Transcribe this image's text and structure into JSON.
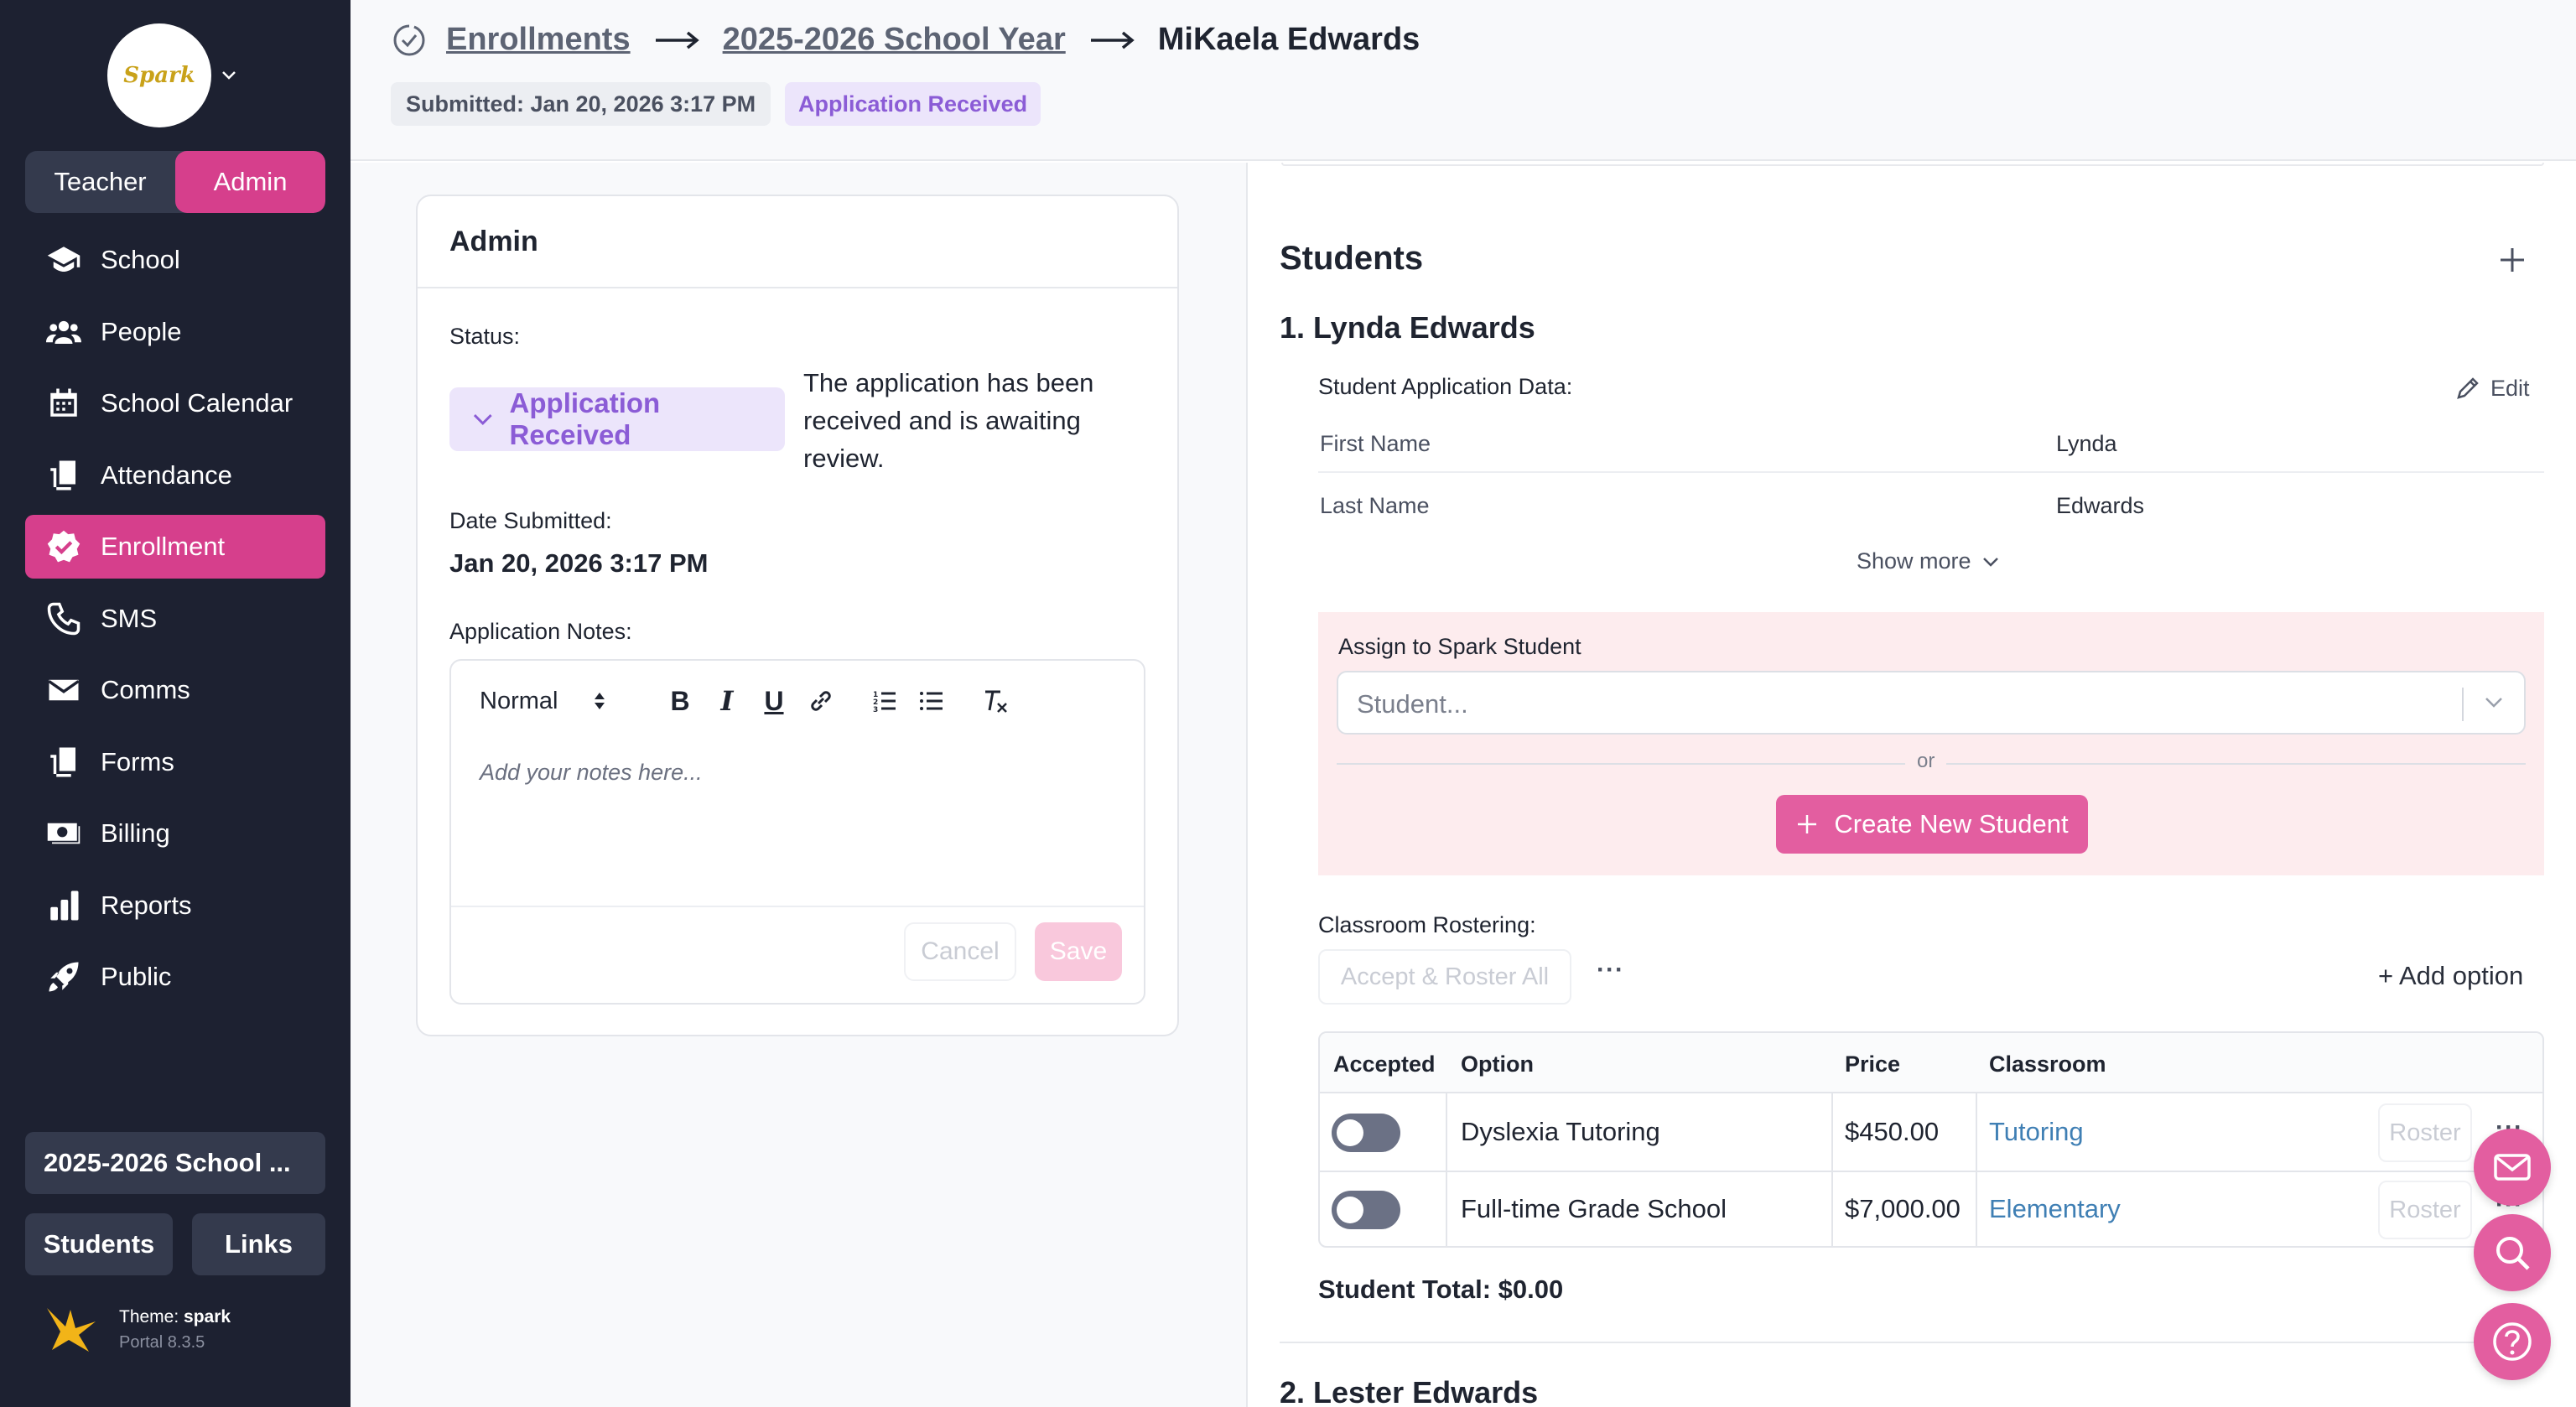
{
  "sidebar": {
    "logo_text": "Spark",
    "role_toggle": [
      "Teacher",
      "Admin"
    ],
    "nav": [
      {
        "label": "School",
        "icon": "graduation-cap-icon"
      },
      {
        "label": "People",
        "icon": "people-icon"
      },
      {
        "label": "School Calendar",
        "icon": "calendar-icon"
      },
      {
        "label": "Attendance",
        "icon": "clipboard-icon"
      },
      {
        "label": "Enrollment",
        "icon": "check-badge-icon",
        "active": true
      },
      {
        "label": "SMS",
        "icon": "phone-icon"
      },
      {
        "label": "Comms",
        "icon": "envelope-icon"
      },
      {
        "label": "Forms",
        "icon": "form-icon"
      },
      {
        "label": "Billing",
        "icon": "money-icon"
      },
      {
        "label": "Reports",
        "icon": "bar-chart-icon"
      },
      {
        "label": "Public",
        "icon": "rocket-icon"
      }
    ],
    "school_year_btn": "2025-2026 School ...",
    "students_btn": "Students",
    "links_btn": "Links",
    "theme_label": "Theme:",
    "theme_name": "spark",
    "portal_version": "Portal 8.3.5"
  },
  "header": {
    "crumb1": "Enrollments",
    "crumb2": "2025-2026 School Year",
    "crumb3": "MiKaela Edwards",
    "submitted": "Submitted: Jan 20, 2026 3:17 PM",
    "status_pill": "Application Received"
  },
  "admin": {
    "title": "Admin",
    "status_label": "Status:",
    "status_value": "Application Received",
    "status_desc": "The application has been received and is awaiting review.",
    "date_label": "Date Submitted:",
    "date_value": "Jan 20, 2026 3:17 PM",
    "notes_label": "Application Notes:",
    "editor_style": "Normal",
    "editor_placeholder": "Add your notes here...",
    "cancel": "Cancel",
    "save": "Save"
  },
  "students": {
    "title": "Students",
    "student1": {
      "name": "1.  Lynda Edwards",
      "data_label": "Student Application Data:",
      "edit": "Edit",
      "fields": [
        {
          "key": "First Name",
          "value": "Lynda"
        },
        {
          "key": "Last Name",
          "value": "Edwards"
        }
      ],
      "show_more": "Show more",
      "assign_label": "Assign to Spark Student",
      "select_placeholder": "Student...",
      "or": "or",
      "create_btn": "Create New Student",
      "rostering_label": "Classroom Rostering:",
      "accept_all": "Accept & Roster All",
      "add_option": "+ Add option",
      "table_headers": [
        "Accepted",
        "Option",
        "Price",
        "Classroom"
      ],
      "rows": [
        {
          "option": "Dyslexia Tutoring",
          "price": "$450.00",
          "classroom": "Tutoring",
          "roster": "Roster"
        },
        {
          "option": "Full-time Grade School",
          "price": "$7,000.00",
          "classroom": "Elementary",
          "roster": "Roster"
        }
      ],
      "total": "Student Total: $0.00"
    },
    "student2_name": "2.  Lester Edwards"
  },
  "colors": {
    "sidebar_bg": "#1d2131",
    "accent": "#d63f8c",
    "status_purple": "#8b5cd6",
    "link_blue": "#3f7fb4"
  }
}
